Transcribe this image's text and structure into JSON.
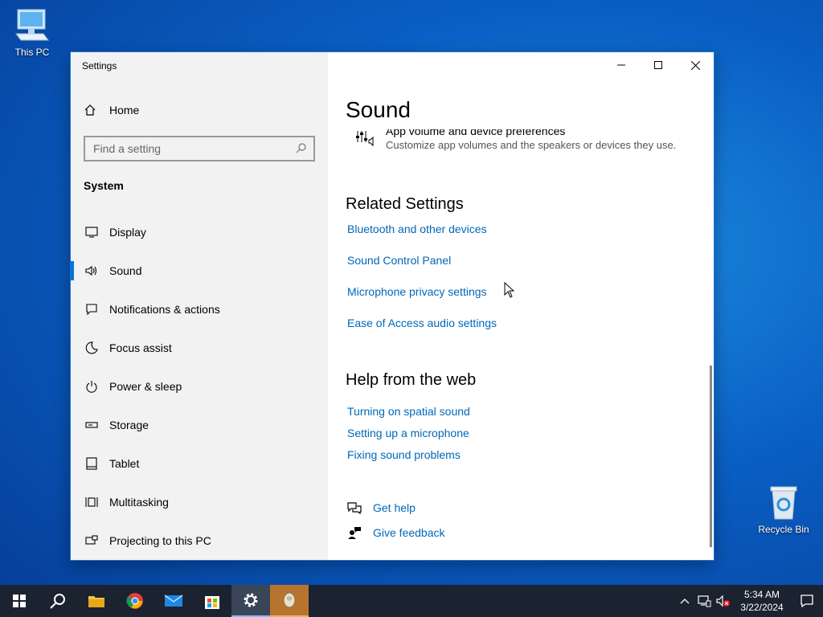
{
  "desktop": {
    "icons": [
      {
        "label": "This PC",
        "icon": "computer-icon"
      },
      {
        "label": "Recycle Bin",
        "icon": "recycle-bin-icon"
      }
    ]
  },
  "window": {
    "title": "Settings",
    "controls": [
      "minimize-icon",
      "maximize-icon",
      "close-icon"
    ]
  },
  "sidebar": {
    "home_label": "Home",
    "search_placeholder": "Find a setting",
    "section_label": "System",
    "items": [
      {
        "label": "Display",
        "icon": "display-icon"
      },
      {
        "label": "Sound",
        "icon": "speaker-icon",
        "active": true
      },
      {
        "label": "Notifications & actions",
        "icon": "notification-icon"
      },
      {
        "label": "Focus assist",
        "icon": "moon-icon"
      },
      {
        "label": "Power & sleep",
        "icon": "power-icon"
      },
      {
        "label": "Storage",
        "icon": "storage-icon"
      },
      {
        "label": "Tablet",
        "icon": "tablet-icon"
      },
      {
        "label": "Multitasking",
        "icon": "multitasking-icon"
      },
      {
        "label": "Projecting to this PC",
        "icon": "projecting-icon"
      }
    ]
  },
  "main": {
    "title": "Sound",
    "app_volume": {
      "title": "App volume and device preferences",
      "description": "Customize app volumes and the speakers or devices they use."
    },
    "related_heading": "Related Settings",
    "related_links": [
      "Bluetooth and other devices",
      "Sound Control Panel",
      "Microphone privacy settings",
      "Ease of Access audio settings"
    ],
    "help_heading": "Help from the web",
    "help_links": [
      "Turning on spatial sound",
      "Setting up a microphone",
      "Fixing sound problems"
    ],
    "get_help": "Get help",
    "give_feedback": "Give feedback"
  },
  "taskbar": {
    "apps": [
      "windows-start-icon",
      "search-icon",
      "file-explorer-icon",
      "chrome-icon",
      "mail-icon",
      "store-icon",
      "settings-icon",
      "app-icon"
    ],
    "time": "5:34 AM",
    "date": "3/22/2024"
  },
  "colors": {
    "accent": "#0078d7",
    "link": "#0068b8",
    "sidebar_bg": "#f2f2f2",
    "taskbar_bg": "#1b2230"
  }
}
